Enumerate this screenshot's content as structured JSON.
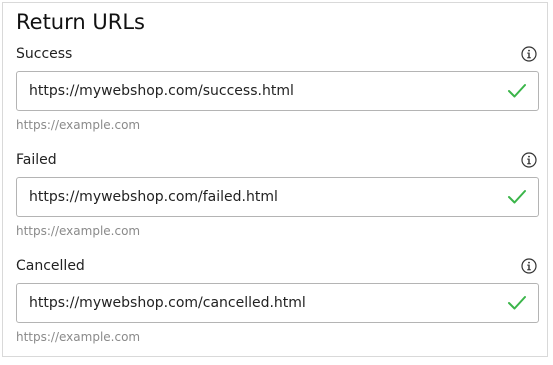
{
  "section": {
    "title": "Return URLs"
  },
  "fields": [
    {
      "label": "Success",
      "value": "https://mywebshop.com/success.html",
      "hint": "https://example.com",
      "info_icon": "info-icon",
      "status_icon": "check-icon"
    },
    {
      "label": "Failed",
      "value": "https://mywebshop.com/failed.html",
      "hint": "https://example.com",
      "info_icon": "info-icon",
      "status_icon": "check-icon"
    },
    {
      "label": "Cancelled",
      "value": "https://mywebshop.com/cancelled.html",
      "hint": "https://example.com",
      "info_icon": "info-icon",
      "status_icon": "check-icon"
    }
  ],
  "colors": {
    "valid": "#3bb54a",
    "border": "#b4b4b4",
    "hint": "#8a8a8a"
  }
}
